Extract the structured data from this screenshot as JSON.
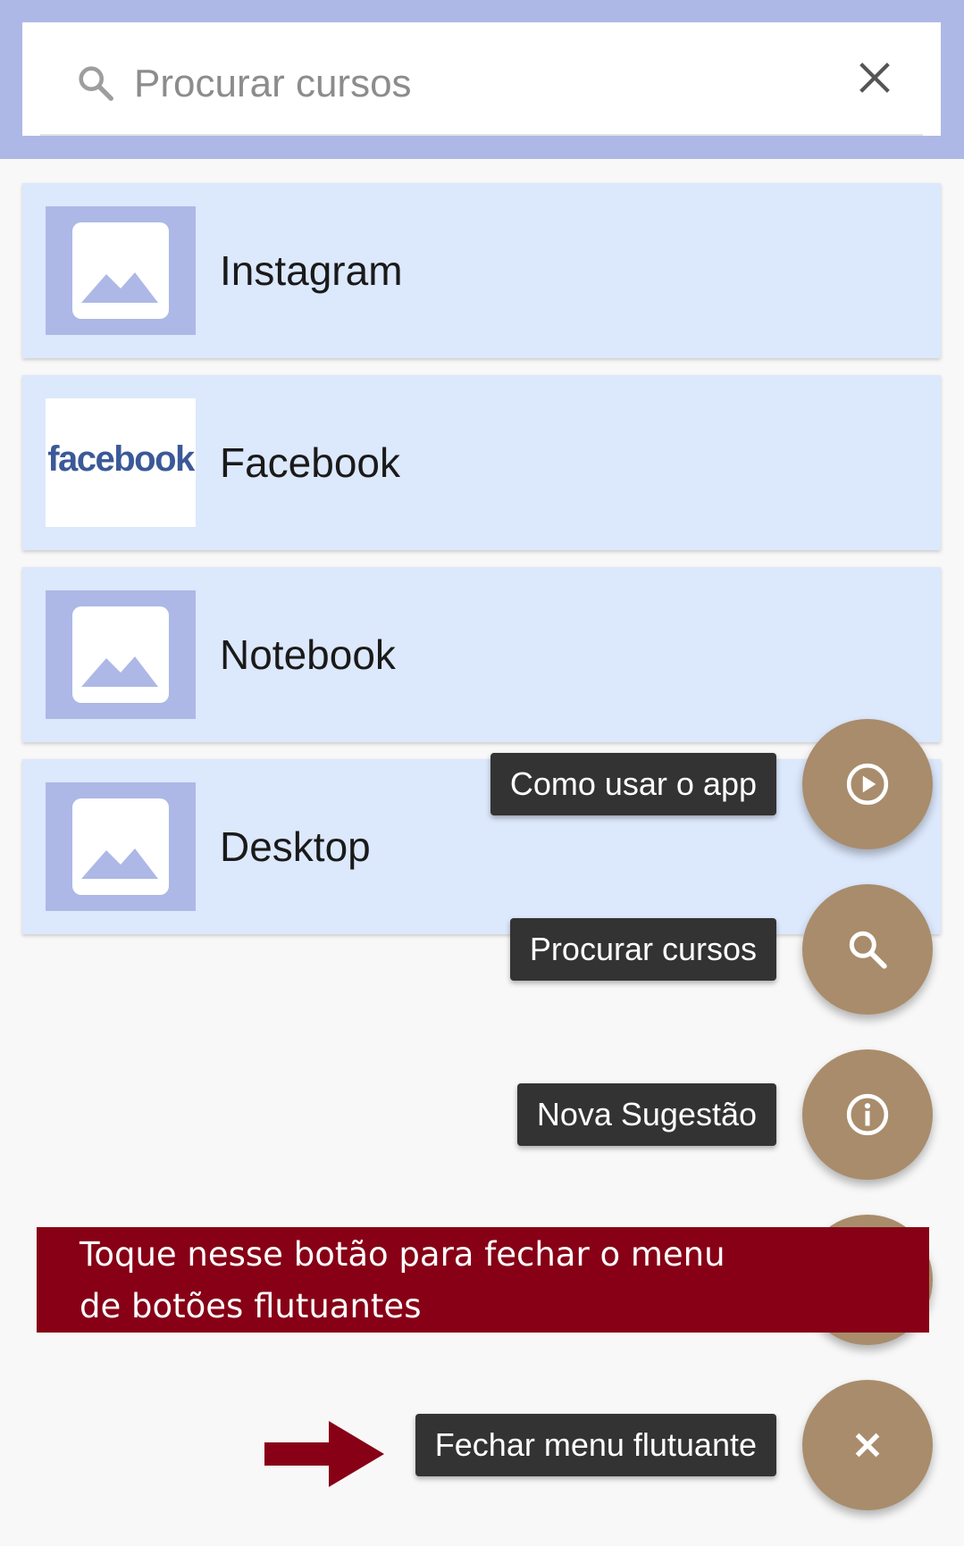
{
  "search": {
    "placeholder": "Procurar cursos",
    "icon": "search-icon",
    "clear_icon": "close-icon"
  },
  "courses": [
    {
      "title": "Instagram",
      "thumbnail": "image-placeholder-icon"
    },
    {
      "title": "Facebook",
      "thumbnail": "facebook-logo",
      "logo_text": "facebook"
    },
    {
      "title": "Notebook",
      "thumbnail": "image-placeholder-icon"
    },
    {
      "title": "Desktop",
      "thumbnail": "image-placeholder-icon"
    }
  ],
  "fab_menu": {
    "items": [
      {
        "label": "Como usar o app",
        "icon": "play-circle-icon"
      },
      {
        "label": "Procurar cursos",
        "icon": "search-icon"
      },
      {
        "label": "Nova Sugestão",
        "icon": "info-icon"
      }
    ],
    "close": {
      "label": "Fechar menu flutuante",
      "icon": "close-icon"
    }
  },
  "annotation": {
    "line1": "Toque nesse botão para fechar o menu",
    "line2": "de botões flutuantes"
  },
  "colors": {
    "header": "#adb8e6",
    "card": "#dce8fc",
    "fab": "#a98c6b",
    "tooltip": "#333333",
    "annotation": "#870016"
  }
}
